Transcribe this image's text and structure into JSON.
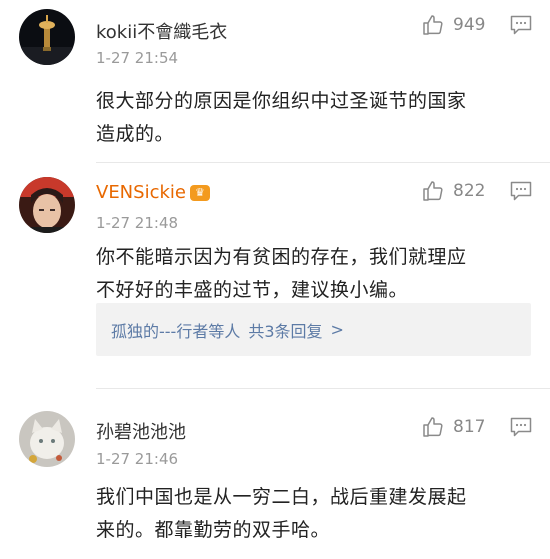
{
  "comments": [
    {
      "username": "kokii不會織毛衣",
      "time": "1-27 21:54",
      "likes": "949",
      "text_lines": [
        "很大部分的原因是你组织中过圣诞节的国家",
        "造成的。"
      ]
    },
    {
      "username": "VENSickie",
      "time": "1-27 21:48",
      "likes": "822",
      "text_lines": [
        "你不能暗示因为有贫困的存在，我们就理应",
        "不好好的丰盛的过节，建议换小编。"
      ],
      "reply_summary": "孤独的---行者等人",
      "reply_count": "共3条回复",
      "reply_arrow": ">"
    },
    {
      "username": "孙碧池池池",
      "time": "1-27 21:46",
      "likes": "817",
      "text_lines": [
        "我们中国也是从一穷二白，战后重建发展起",
        "来的。都靠勤劳的双手哈。"
      ]
    }
  ],
  "icons": {
    "like": "thumbs-up-icon",
    "reply": "comment-bubble-icon",
    "badge": "vip-crown-badge-icon"
  },
  "colors": {
    "username_1": "#333333",
    "username_2": "#e86800",
    "reply_link": "#5d7ba6",
    "badge": "#f39a1e"
  }
}
